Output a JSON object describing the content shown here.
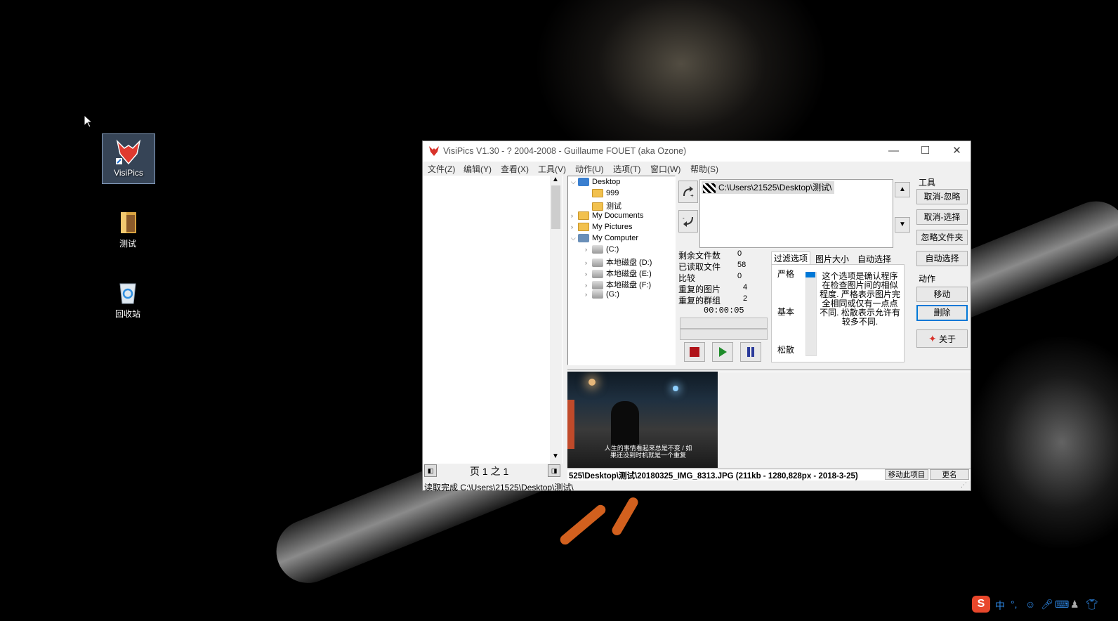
{
  "desktop": {
    "icons": [
      {
        "label": "VisiPics"
      },
      {
        "label": "测试"
      },
      {
        "label": "回收站"
      }
    ]
  },
  "window": {
    "title": "VisiPics V1.30 - ? 2004-2008 - Guillaume FOUET (aka Ozone)",
    "controls": {
      "minimize": "—",
      "maximize": "☐",
      "close": "✕"
    },
    "menu": [
      "文件(Z)",
      "编辑(Y)",
      "查看(X)",
      "工具(V)",
      "动作(U)",
      "选项(T)",
      "窗口(W)",
      "帮助(S)"
    ],
    "pager": {
      "label": "页 1 之 1"
    },
    "tree": [
      {
        "label": "Desktop",
        "expanded": true
      },
      {
        "label": "999"
      },
      {
        "label": "测试"
      },
      {
        "label": "My Documents"
      },
      {
        "label": "My Pictures"
      },
      {
        "label": "My Computer",
        "expanded": true
      },
      {
        "label": "(C:)"
      },
      {
        "label": "本地磁盘 (D:)"
      },
      {
        "label": "本地磁盘 (E:)"
      },
      {
        "label": "本地磁盘 (F:)"
      },
      {
        "label": "(G:)"
      }
    ],
    "folder_path": "C:\\Users\\21525\\Desktop\\测试\\",
    "stats": [
      {
        "label": "剩余文件数",
        "value": "0"
      },
      {
        "label": "已读取文件",
        "value": "58"
      },
      {
        "label": "比较",
        "value": "0"
      },
      {
        "label": "重复的图片",
        "value": "4"
      },
      {
        "label": "重复的群组",
        "value": "2"
      }
    ],
    "timer": "00:00:05",
    "tabs": [
      "过滤选项",
      "图片大小",
      "自动选择"
    ],
    "filter": {
      "levels": [
        "严格",
        "基本",
        "松散"
      ],
      "description": "这个选项是确认程序在检查图片间的相似程度. 严格表示图片完全相同或仅有一点点不同. 松散表示允许有较多不同."
    },
    "tools": {
      "title": "工具",
      "buttons": [
        "取消-忽略",
        "取消-选择",
        "忽略文件夹",
        "自动选择"
      ]
    },
    "actions": {
      "title": "动作",
      "buttons": [
        "移动",
        "删除"
      ],
      "about": "关于"
    },
    "preview_caption": "人生的事情看起来总是不变 / 如果还没到时机就是一个重复",
    "file_info": "525\\Desktop\\测试\\20180325_IMG_8313.JPG (211kb - 1280,828px - 2018-3-25)",
    "info_buttons": [
      "移动此项目",
      "更名"
    ],
    "status": "读取完成 C:\\Users\\21525\\Desktop\\测试\\"
  },
  "tray": {
    "ime": "中",
    "punct": "°,"
  },
  "colors": {
    "accent": "#0078d7",
    "stop": "#b0141a",
    "play": "#1e8c2a",
    "pause": "#2a3a9a"
  }
}
